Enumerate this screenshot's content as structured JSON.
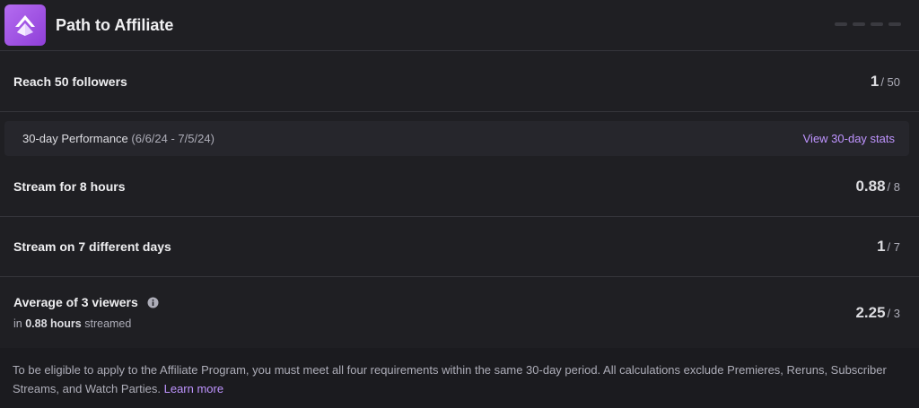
{
  "header": {
    "title": "Path to Affiliate",
    "logo_icon": "affiliate-chevron-icon",
    "accent": "#a855f7"
  },
  "followers": {
    "label": "Reach 50 followers",
    "current": "1",
    "total": "/ 50"
  },
  "performance": {
    "label": "30-day Performance",
    "dates": "(6/6/24 - 7/5/24)",
    "link": "View 30-day stats"
  },
  "requirements": [
    {
      "label": "Stream for 8 hours",
      "current": "0.88",
      "total": "/ 8"
    },
    {
      "label": "Stream on 7 different days",
      "current": "1",
      "total": "/ 7"
    },
    {
      "label": "Average of 3 viewers",
      "sub_prefix": "in",
      "sub_value": "0.88 hours",
      "sub_suffix": "streamed",
      "current": "2.25",
      "total": "/ 3"
    }
  ],
  "footer": {
    "text": "To be eligible to apply to the Affiliate Program, you must meet all four requirements within the same 30-day period. All calculations exclude Premieres, Reruns, Subscriber Streams, and Watch Parties.",
    "link": "Learn more"
  },
  "colors": {
    "background": "#1f1f23",
    "link": "#bf94ff",
    "divider": "#35353b"
  }
}
